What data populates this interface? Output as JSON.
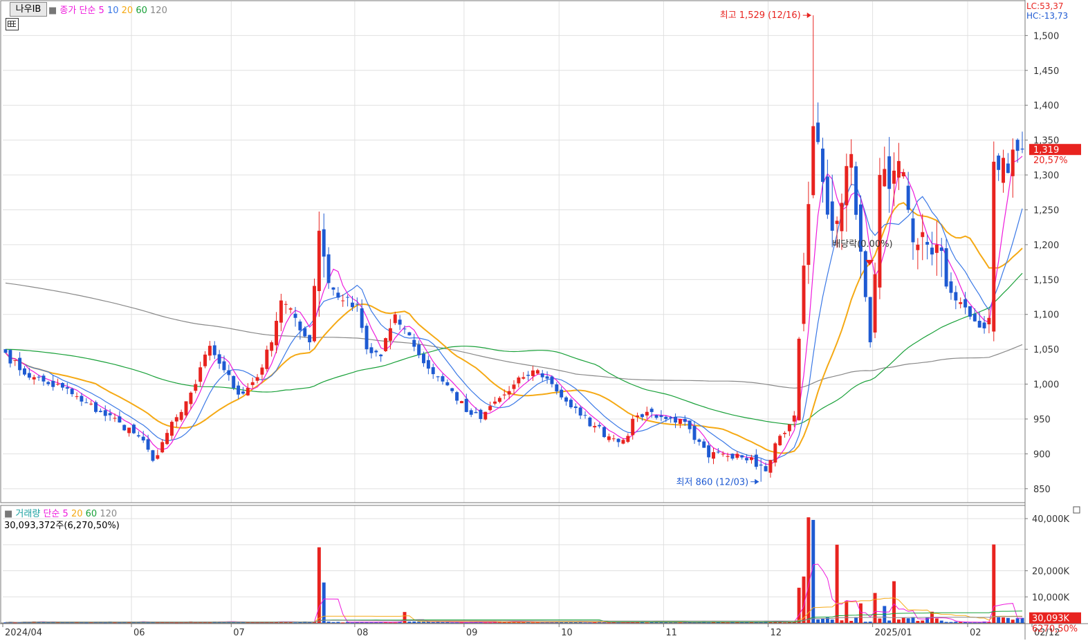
{
  "header": {
    "stock_name": "나우IB",
    "price_ma_label": "종가 단순",
    "ma_periods": [
      "5",
      "10",
      "20",
      "60",
      "120"
    ],
    "lc_text": "LC:53,37",
    "hc_text": "HC:-13,73"
  },
  "volume_header": {
    "label": "거래량",
    "ma_label": "단순",
    "ma_periods": [
      "5",
      "20",
      "60",
      "120"
    ],
    "last_volume_text": "30,093,372주(6,270,50%)"
  },
  "colors": {
    "up": "#e8231f",
    "down": "#1e5ad2",
    "ma5": "#ee1adc",
    "ma10": "#3a78e6",
    "ma20": "#f5a914",
    "ma60": "#18a038",
    "ma120": "#888888",
    "grid": "#e0e0e0"
  },
  "chart_data": [
    {
      "type": "candlestick",
      "y_axis_ticks": [
        "1,500",
        "1,450",
        "1,400",
        "1,350",
        "1,300",
        "1,250",
        "1,200",
        "1,150",
        "1,100",
        "1,050",
        "1,000",
        "950",
        "900",
        "850"
      ],
      "ylim": [
        830,
        1545
      ],
      "x_axis_ticks": [
        "2024/04",
        "06",
        "07",
        "08",
        "09",
        "10",
        "11",
        "12",
        "2025/01",
        "02",
        "02/12"
      ],
      "n_days": 215,
      "month_start_index": {
        "06": 27,
        "07": 48,
        "08": 74,
        "09": 97,
        "10": 117,
        "11": 139,
        "12": 161,
        "2025/01": 183,
        "02": 203
      },
      "anchor_closes": [
        [
          0,
          1045
        ],
        [
          3,
          1020
        ],
        [
          6,
          1010
        ],
        [
          9,
          1000
        ],
        [
          12,
          995
        ],
        [
          16,
          975
        ],
        [
          20,
          960
        ],
        [
          24,
          945
        ],
        [
          28,
          925
        ],
        [
          31,
          890
        ],
        [
          34,
          930
        ],
        [
          37,
          960
        ],
        [
          40,
          1000
        ],
        [
          43,
          1055
        ],
        [
          46,
          1020
        ],
        [
          49,
          985
        ],
        [
          53,
          1010
        ],
        [
          56,
          1060
        ],
        [
          58,
          1120
        ],
        [
          61,
          1095
        ],
        [
          64,
          1060
        ],
        [
          66,
          1220
        ],
        [
          68,
          1145
        ],
        [
          71,
          1120
        ],
        [
          74,
          1115
        ],
        [
          76,
          1050
        ],
        [
          79,
          1040
        ],
        [
          82,
          1100
        ],
        [
          85,
          1070
        ],
        [
          88,
          1030
        ],
        [
          91,
          1010
        ],
        [
          94,
          990
        ],
        [
          97,
          960
        ],
        [
          100,
          950
        ],
        [
          103,
          975
        ],
        [
          106,
          990
        ],
        [
          109,
          1010
        ],
        [
          112,
          1020
        ],
        [
          115,
          1000
        ],
        [
          118,
          975
        ],
        [
          121,
          955
        ],
        [
          124,
          940
        ],
        [
          127,
          925
        ],
        [
          130,
          920
        ],
        [
          133,
          955
        ],
        [
          136,
          960
        ],
        [
          139,
          950
        ],
        [
          142,
          950
        ],
        [
          145,
          920
        ],
        [
          148,
          895
        ],
        [
          151,
          900
        ],
        [
          154,
          900
        ],
        [
          157,
          895
        ],
        [
          160,
          875
        ],
        [
          162,
          915
        ],
        [
          164,
          930
        ],
        [
          166,
          955
        ],
        [
          168,
          1170
        ],
        [
          170,
          1370
        ],
        [
          172,
          1290
        ],
        [
          174,
          1220
        ],
        [
          176,
          1260
        ],
        [
          178,
          1330
        ],
        [
          180,
          1190
        ],
        [
          182,
          1060
        ],
        [
          184,
          1300
        ],
        [
          186,
          1280
        ],
        [
          188,
          1320
        ],
        [
          190,
          1250
        ],
        [
          192,
          1200
        ],
        [
          194,
          1200
        ],
        [
          196,
          1200
        ],
        [
          198,
          1140
        ],
        [
          200,
          1120
        ],
        [
          202,
          1110
        ],
        [
          204,
          1090
        ],
        [
          206,
          1080
        ],
        [
          207,
          1095
        ],
        [
          208,
          1319
        ]
      ],
      "highlight": [
        {
          "index": 170,
          "high": 1529
        },
        {
          "index": 159,
          "low": 860
        }
      ],
      "annotations": [
        {
          "text": "최고 1,529 (12/16)",
          "index": 170,
          "value": 1529,
          "color": "#e8231f",
          "arrow": "right"
        },
        {
          "text": "최저 860 (12/03)",
          "index": 159,
          "value": 860,
          "color": "#1e5ad2",
          "arrow": "right"
        },
        {
          "text": "배당락(0.00%)",
          "index": 181,
          "value": 1200,
          "color": "#333333",
          "arrow": "down"
        }
      ],
      "last_price_label": "1,319",
      "last_change_label": "20,57%",
      "series_ma": [
        "5",
        "10",
        "20",
        "60",
        "120"
      ]
    },
    {
      "type": "bar",
      "title": "거래량",
      "y_axis_ticks": [
        "40,000K",
        "20,000K",
        "10,000K"
      ],
      "ylim": [
        0,
        44000
      ],
      "volume_spikes": [
        {
          "index": 66,
          "value": 29000,
          "dir": "up"
        },
        {
          "index": 67,
          "value": 15500,
          "dir": "down"
        },
        {
          "index": 84,
          "value": 4200,
          "dir": "up"
        },
        {
          "index": 167,
          "value": 13500,
          "dir": "up"
        },
        {
          "index": 168,
          "value": 17800,
          "dir": "up"
        },
        {
          "index": 169,
          "value": 40500,
          "dir": "up"
        },
        {
          "index": 170,
          "value": 39500,
          "dir": "down"
        },
        {
          "index": 175,
          "value": 30000,
          "dir": "up"
        },
        {
          "index": 177,
          "value": 8500,
          "dir": "up"
        },
        {
          "index": 180,
          "value": 7500,
          "dir": "up"
        },
        {
          "index": 183,
          "value": 11500,
          "dir": "up"
        },
        {
          "index": 185,
          "value": 6500,
          "dir": "down"
        },
        {
          "index": 187,
          "value": 16000,
          "dir": "up"
        },
        {
          "index": 195,
          "value": 4300,
          "dir": "up"
        },
        {
          "index": 208,
          "value": 30093,
          "dir": "up"
        }
      ],
      "last_volume_label": "30,093K",
      "last_volume_pct_label": "6270,50%",
      "series_ma": [
        "5",
        "20",
        "60",
        "120"
      ]
    }
  ]
}
